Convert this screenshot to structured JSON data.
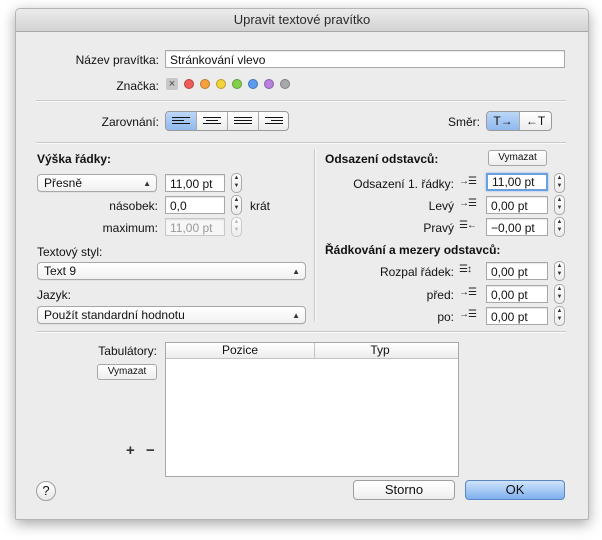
{
  "window": {
    "title": "Upravit textové pravítko"
  },
  "name_field": {
    "label": "Název pravítka:",
    "value": "Stránkování vlevo"
  },
  "tag": {
    "label": "Značka:",
    "clear_glyph": "×",
    "colors": [
      "#f05a5a",
      "#f5a13c",
      "#f2d33a",
      "#83cf4a",
      "#5b9cf0",
      "#b781e0",
      "#a9a9a9"
    ]
  },
  "alignment": {
    "label": "Zarovnání:",
    "selected": "left"
  },
  "direction": {
    "label": "Směr:",
    "ltr": "T→",
    "rtl": "←T"
  },
  "line_height": {
    "heading": "Výška řádky:",
    "mode": "Přesně",
    "value": "11,00 pt",
    "multiple_label": "násobek:",
    "multiple_value": "0,0",
    "multiple_unit": "krát",
    "max_label": "maximum:",
    "max_value": "11,00 pt"
  },
  "text_style": {
    "label": "Textový styl:",
    "value": "Text 9"
  },
  "language": {
    "label": "Jazyk:",
    "value": "Použít standardní hodnotu"
  },
  "indents": {
    "heading": "Odsazení odstavců:",
    "clear_label": "Vymazat",
    "first_line_label": "Odsazení 1. řádky:",
    "first_line_value": "11,00 pt",
    "left_label": "Levý",
    "left_value": "0,00 pt",
    "right_label": "Pravý",
    "right_value": "−0,00 pt"
  },
  "spacing": {
    "heading": "Řádkování a mezery odstavců:",
    "leading_label": "Rozpal řádek:",
    "leading_value": "0,00 pt",
    "before_label": "před:",
    "before_value": "0,00 pt",
    "after_label": "po:",
    "after_value": "0,00 pt"
  },
  "tabs": {
    "label": "Tabulátory:",
    "clear_label": "Vymazat",
    "col_position": "Pozice",
    "col_type": "Typ",
    "add": "+",
    "remove": "−"
  },
  "footer": {
    "help": "?",
    "cancel": "Storno",
    "ok": "OK"
  }
}
